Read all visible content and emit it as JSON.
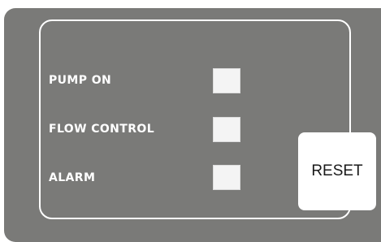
{
  "panel": {
    "rows": [
      {
        "label": "PUMP ON",
        "indicator": "off"
      },
      {
        "label": "FLOW CONTROL",
        "indicator": "off"
      },
      {
        "label": "ALARM",
        "indicator": "off"
      }
    ],
    "reset_label": "RESET"
  },
  "colors": {
    "panel_background": "#7a7a78",
    "label_text": "#ffffff",
    "indicator_off": "#f4f4f4",
    "button_background": "#ffffff"
  }
}
